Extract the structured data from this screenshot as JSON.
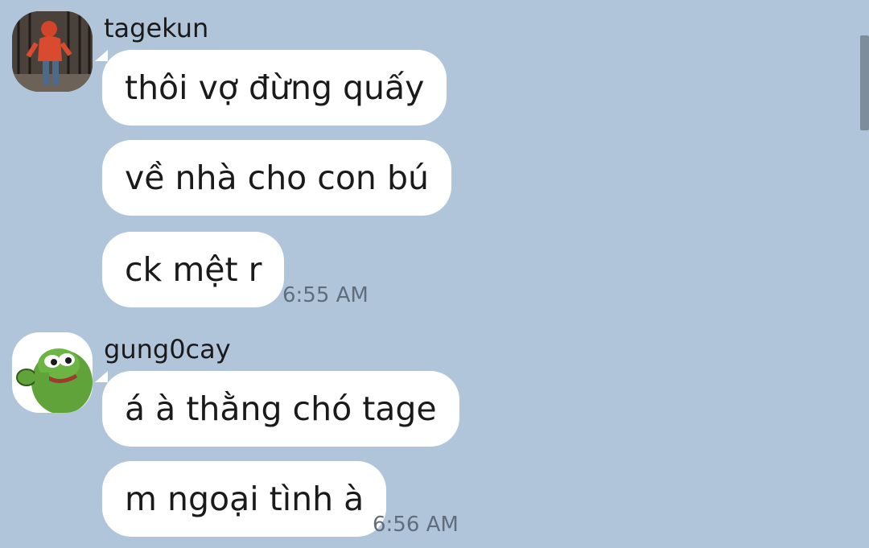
{
  "messages": [
    {
      "sender": "tagekun",
      "avatar": "user-photo-avatar",
      "bubbles": [
        "thôi vợ đừng quấy",
        "về nhà cho con bú",
        "ck mệt r"
      ],
      "time": "6:55 AM"
    },
    {
      "sender": "gung0cay",
      "avatar": "frog-avatar",
      "bubbles": [
        "á à thằng chó tage",
        "m ngoại tình à"
      ],
      "time": "6:56 AM"
    }
  ],
  "colors": {
    "background": "#b1c5da",
    "bubble": "#ffffff",
    "text": "#1a1a1a",
    "timestamp": "#5f6d7c"
  }
}
